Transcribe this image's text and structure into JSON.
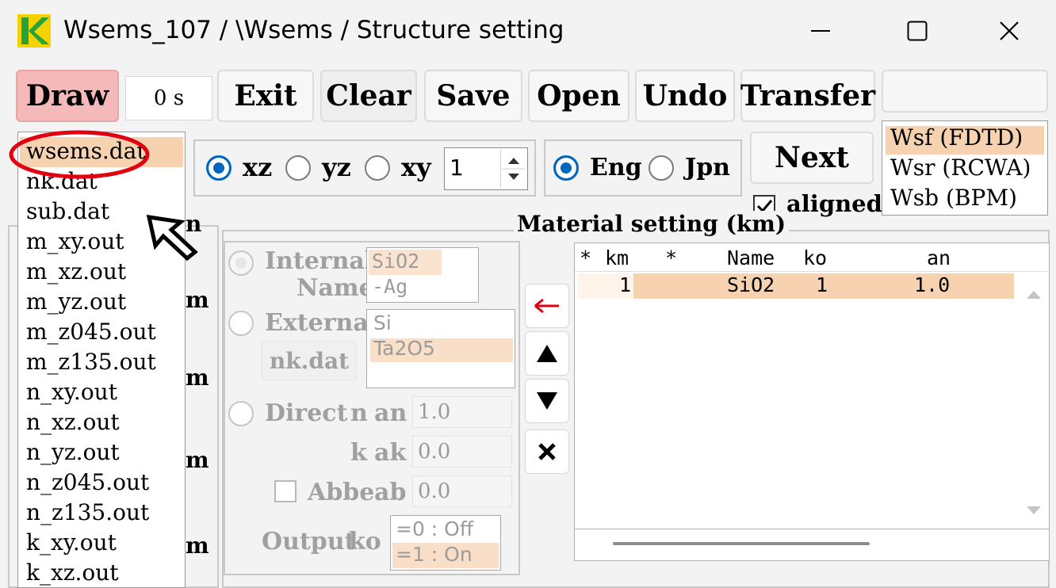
{
  "window": {
    "title": "Wsems_107 / \\Wsems / Structure setting"
  },
  "toolbar": {
    "draw": "Draw",
    "timer": "0 s",
    "exit": "Exit",
    "clear": "Clear",
    "save": "Save",
    "open": "Open",
    "undo": "Undo",
    "transfer": "Transfer"
  },
  "plane": {
    "options": [
      "xz",
      "yz",
      "xy"
    ],
    "selected": "xz",
    "index_value": "1"
  },
  "language": {
    "options": [
      "Eng",
      "Jpn"
    ],
    "selected": "Eng"
  },
  "next": {
    "label": "Next",
    "aligned_label": "aligned",
    "aligned_checked": true
  },
  "solvers": {
    "items": [
      "Wsf (FDTD)",
      "Wsr (RCWA)",
      "Wsb (BPM)"
    ],
    "selected": "Wsf (FDTD)"
  },
  "files": {
    "items": [
      "wsems.dat",
      "nk.dat",
      "sub.dat",
      "m_xy.out",
      "m_xz.out",
      "m_yz.out",
      "m_z045.out",
      "m_z135.out",
      "n_xy.out",
      "n_xz.out",
      "n_yz.out",
      "n_z045.out",
      "n_z135.out",
      "k_xy.out",
      "k_xz.out"
    ],
    "selected": "wsems.dat"
  },
  "hidden_labels": {
    "m": "m",
    "n": "n"
  },
  "material": {
    "title": "Material setting (km)",
    "internal_label": "Internal",
    "name_label": "Name",
    "internal_items": [
      "SiO2",
      "-Ag"
    ],
    "external_label": "External",
    "external_items": [
      "Si",
      "Ta2O5"
    ],
    "nk_button": "nk.dat",
    "direct_label": "Direct",
    "n_label": "n",
    "an_label": "an",
    "an_value": "1.0",
    "k_label": "k",
    "ak_label": "ak",
    "ak_value": "0.0",
    "abbe_label": "Abbe",
    "ab_label": "ab",
    "ab_value": "0.0",
    "output_label": "Output",
    "ko_label": "ko",
    "output_items": [
      "=0 : Off",
      "=1 : On"
    ]
  },
  "table": {
    "header": {
      "c1": "*",
      "km": "km",
      "c2": "*",
      "name": "Name",
      "ko": "ko",
      "an": "an"
    },
    "rows": [
      {
        "km": "1",
        "name": "SiO2",
        "ko": "1",
        "an": "1.0"
      }
    ]
  },
  "colors": {
    "selection": "#f6d2b0",
    "accent": "#0067c0",
    "draw_button": "#f6b9b9",
    "annotation": "#e0000f"
  }
}
